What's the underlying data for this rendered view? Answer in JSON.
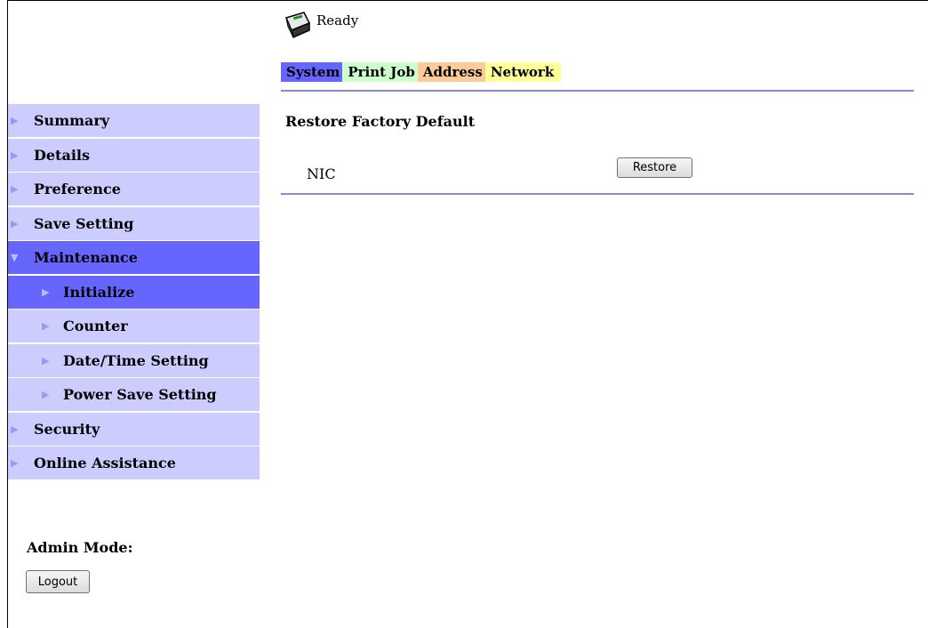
{
  "status": {
    "icon": "printer-icon",
    "text": "Ready"
  },
  "tabs": [
    {
      "label": "System",
      "color": "#6666ff"
    },
    {
      "label": "Print Job",
      "color": "#ccffcc"
    },
    {
      "label": "Address",
      "color": "#ffcc99"
    },
    {
      "label": "Network",
      "color": "#ffff99"
    }
  ],
  "main": {
    "section_title": "Restore Factory Default",
    "rows": [
      {
        "label": "NIC",
        "button_label": "Restore"
      }
    ]
  },
  "sidebar": {
    "items": [
      {
        "label": "Summary",
        "icon": "triangle-right-icon"
      },
      {
        "label": "Details",
        "icon": "triangle-right-icon"
      },
      {
        "label": "Preference",
        "icon": "triangle-right-icon"
      },
      {
        "label": "Save Setting",
        "icon": "triangle-right-icon"
      },
      {
        "label": "Maintenance",
        "icon": "triangle-down-icon",
        "expanded": true
      },
      {
        "label": "Initialize",
        "icon": "triangle-right-icon",
        "selected": true
      },
      {
        "label": "Counter",
        "icon": "triangle-right-icon"
      },
      {
        "label": "Date/Time Setting",
        "icon": "triangle-right-icon"
      },
      {
        "label": "Power Save Setting",
        "icon": "triangle-right-icon"
      },
      {
        "label": "Security",
        "icon": "triangle-right-icon"
      },
      {
        "label": "Online Assistance",
        "icon": "triangle-right-icon"
      }
    ]
  },
  "admin": {
    "label": "Admin Mode:",
    "logout_label": "Logout"
  },
  "colors": {
    "accent": "#6666ff",
    "nav_bg": "#ccccff",
    "divider": "#8888dd"
  }
}
